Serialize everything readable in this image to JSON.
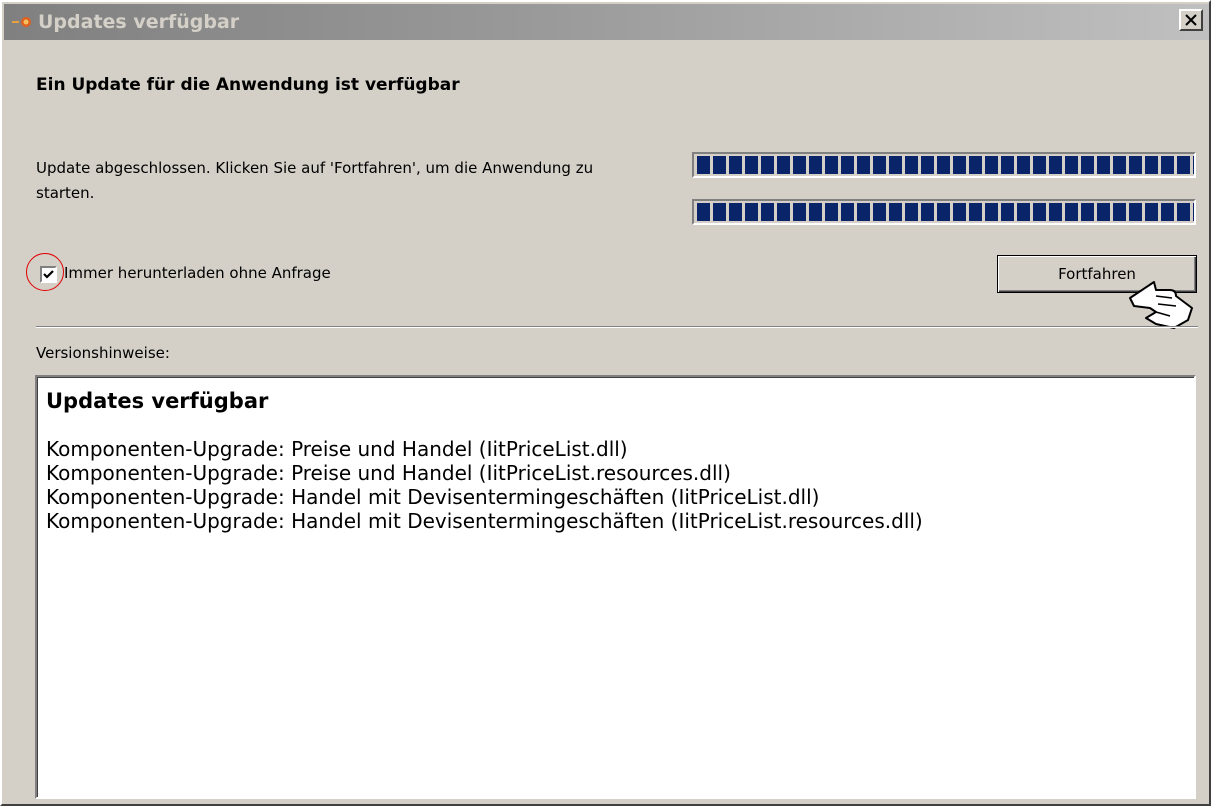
{
  "window": {
    "title": "Updates verfügbar",
    "heading": "Ein Update für die Anwendung ist verfügbar",
    "status_text": "Update abgeschlossen. Klicken Sie auf 'Fortfahren', um die Anwendung zu starten.",
    "progress": [
      1.0,
      1.0
    ],
    "checkbox": {
      "label": "Immer herunterladen ohne Anfrage",
      "checked": true
    },
    "continue_label": "Fortfahren",
    "notes_label": "Versionshinweise:",
    "notes": {
      "title": "Updates verfügbar",
      "lines": [
        "Komponenten-Upgrade: Preise und Handel (IitPriceList.dll)",
        "Komponenten-Upgrade: Preise und Handel (IitPriceList.resources.dll)",
        "Komponenten-Upgrade: Handel mit Devisentermingeschäften (IitPriceList.dll)",
        "Komponenten-Upgrade: Handel mit Devisentermingeschäften (IitPriceList.resources.dll)"
      ]
    }
  },
  "icons": {
    "app": "app-icon",
    "close": "close-icon",
    "check": "check-icon",
    "cursor": "hand-cursor-icon",
    "annotation": "red-circle-annotation"
  },
  "colors": {
    "progress_fill": "#0a246a",
    "annotation": "#e00000",
    "dialog_bg": "#d4d0c8"
  }
}
